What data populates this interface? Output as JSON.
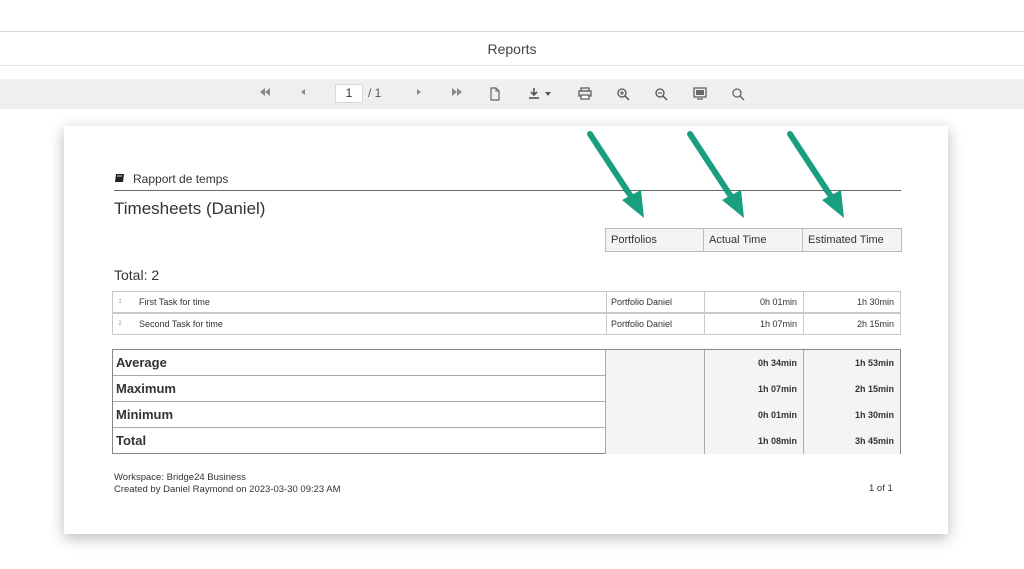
{
  "app": {
    "title": "Reports"
  },
  "toolbar": {
    "page_current": "1",
    "page_total": "/ 1",
    "buttons": [
      "first-page-icon",
      "prev-page-icon",
      "next-page-icon",
      "last-page-icon",
      "new-document-icon",
      "download-icon",
      "print-icon",
      "zoom-in-icon",
      "zoom-out-icon",
      "fullscreen-icon",
      "search-icon"
    ]
  },
  "report": {
    "section_label": "Rapport de temps",
    "title": "Timesheets (Daniel)",
    "columns": [
      "Portfolios",
      "Actual Time",
      "Estimated Time"
    ],
    "total_label": "Total: 2",
    "rows": [
      {
        "idx": "1",
        "task": "First Task for time",
        "portfolio": "Portfolio Daniel",
        "actual": "0h 01min",
        "estimated": "1h 30min"
      },
      {
        "idx": "2",
        "task": "Second Task for time",
        "portfolio": "Portfolio Daniel",
        "actual": "1h 07min",
        "estimated": "2h 15min"
      }
    ],
    "aggregates": [
      {
        "label": "Average",
        "actual": "0h 34min",
        "estimated": "1h 53min"
      },
      {
        "label": "Maximum",
        "actual": "1h 07min",
        "estimated": "2h 15min"
      },
      {
        "label": "Minimum",
        "actual": "0h 01min",
        "estimated": "1h 30min"
      },
      {
        "label": "Total",
        "actual": "1h 08min",
        "estimated": "3h 45min"
      }
    ],
    "workspace": "Workspace: Bridge24 Business",
    "created_by": "Created by Daniel Raymond on 2023-03-30 09:23 AM",
    "pager": "1 of 1"
  },
  "colors": {
    "arrow": "#1a9e80",
    "toolbar_bg": "#efefef",
    "header_bg": "#f4f4f4"
  }
}
